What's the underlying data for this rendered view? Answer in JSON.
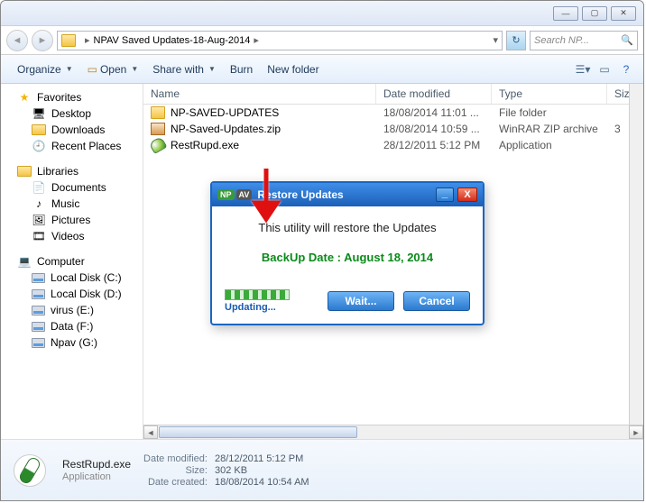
{
  "titlebar": {
    "min": "—",
    "max": "▢",
    "close": "✕"
  },
  "address": {
    "path": "NPAV Saved Updates-18-Aug-2014",
    "sep": "▸",
    "refresh": "↻",
    "search_placeholder": "Search NP..."
  },
  "toolbar": {
    "organize": "Organize",
    "open": "Open",
    "sharewith": "Share with",
    "burn": "Burn",
    "newfolder": "New folder",
    "help": "?"
  },
  "nav": {
    "favorites": "Favorites",
    "fav_items": [
      "Desktop",
      "Downloads",
      "Recent Places"
    ],
    "libraries": "Libraries",
    "lib_items": [
      "Documents",
      "Music",
      "Pictures",
      "Videos"
    ],
    "computer": "Computer",
    "comp_items": [
      "Local Disk (C:)",
      "Local Disk (D:)",
      "virus (E:)",
      "Data (F:)",
      "Npav (G:)"
    ]
  },
  "columns": {
    "name": "Name",
    "date": "Date modified",
    "type": "Type",
    "size": "Size"
  },
  "files": [
    {
      "name": "NP-SAVED-UPDATES",
      "date": "18/08/2014 11:01 ...",
      "type": "File folder",
      "size": "",
      "icon": "folder"
    },
    {
      "name": "NP-Saved-Updates.zip",
      "date": "18/08/2014 10:59 ...",
      "type": "WinRAR ZIP archive",
      "size": "3",
      "icon": "zip"
    },
    {
      "name": "RestRupd.exe",
      "date": "28/12/2011 5:12 PM",
      "type": "Application",
      "size": "",
      "icon": "exe"
    }
  ],
  "details": {
    "name": "RestRupd.exe",
    "type": "Application",
    "lbl_modified": "Date modified:",
    "modified": "28/12/2011 5:12 PM",
    "lbl_size": "Size:",
    "size": "302 KB",
    "lbl_created": "Date created:",
    "created": "18/08/2014 10:54 AM"
  },
  "dialog": {
    "logo_np": "NP",
    "logo_av": "AV",
    "title": "Restore Updates",
    "message": "This utility will restore the Updates",
    "date_line": "BackUp Date : August 18, 2014",
    "updating": "Updating...",
    "wait": "Wait...",
    "cancel": "Cancel"
  }
}
